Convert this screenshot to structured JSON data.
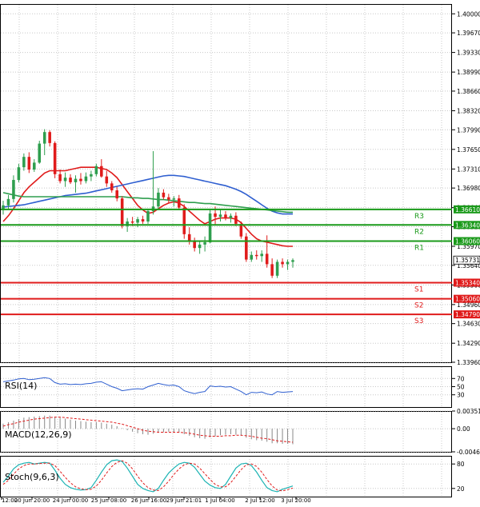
{
  "chart_data": [
    {
      "type": "candlestick",
      "panel": "price",
      "y_ticks": [
        "1.40000",
        "1.39670",
        "1.39330",
        "1.38990",
        "1.38660",
        "1.38320",
        "1.37990",
        "1.37650",
        "1.37310",
        "1.36980",
        "1.36640",
        "1.36310",
        "1.35970",
        "1.35640",
        "1.35300",
        "1.34960",
        "1.34630",
        "1.34290",
        "1.33960"
      ],
      "ylim": [
        1.3396,
        1.4017
      ],
      "x_ticks": [
        "12:00",
        "20 Jun 20:00",
        "24 Jun 00:00",
        "25 Jun 08:00",
        "26 Jun 16:00",
        "29 Jun 21:01",
        "1 Jul 04:00",
        "2 Jul 12:00",
        "3 Jul 20:00"
      ],
      "candles": [
        [
          1.366,
          1.3676,
          1.3652,
          1.3668
        ],
        [
          1.3668,
          1.3686,
          1.3662,
          1.3679
        ],
        [
          1.3679,
          1.372,
          1.3673,
          1.3712
        ],
        [
          1.3712,
          1.374,
          1.3708,
          1.3734
        ],
        [
          1.3734,
          1.3758,
          1.3728,
          1.3752
        ],
        [
          1.3752,
          1.376,
          1.3724,
          1.373
        ],
        [
          1.373,
          1.3748,
          1.3726,
          1.3742
        ],
        [
          1.3742,
          1.378,
          1.374,
          1.3775
        ],
        [
          1.3775,
          1.38,
          1.3755,
          1.3795
        ],
        [
          1.3795,
          1.3798,
          1.377,
          1.3776
        ],
        [
          1.3776,
          1.3779,
          1.3715,
          1.3722
        ],
        [
          1.3722,
          1.373,
          1.3706,
          1.371
        ],
        [
          1.371,
          1.3725,
          1.37,
          1.3716
        ],
        [
          1.3716,
          1.3722,
          1.3705,
          1.3708
        ],
        [
          1.3708,
          1.372,
          1.369,
          1.3714
        ],
        [
          1.3714,
          1.3724,
          1.3704,
          1.371
        ],
        [
          1.371,
          1.3725,
          1.3706,
          1.3718
        ],
        [
          1.3718,
          1.3728,
          1.371,
          1.3722
        ],
        [
          1.3722,
          1.374,
          1.3718,
          1.3736
        ],
        [
          1.3736,
          1.3748,
          1.3716,
          1.3718
        ],
        [
          1.3718,
          1.3728,
          1.37,
          1.3706
        ],
        [
          1.3706,
          1.371,
          1.369,
          1.3694
        ],
        [
          1.3694,
          1.37,
          1.3675,
          1.368
        ],
        [
          1.368,
          1.3684,
          1.3628,
          1.3632
        ],
        [
          1.3632,
          1.3646,
          1.3622,
          1.364
        ],
        [
          1.364,
          1.3648,
          1.3632,
          1.3638
        ],
        [
          1.3638,
          1.3648,
          1.363,
          1.3644
        ],
        [
          1.3644,
          1.365,
          1.3636,
          1.364
        ],
        [
          1.364,
          1.3662,
          1.3636,
          1.3658
        ],
        [
          1.3658,
          1.3762,
          1.3652,
          1.3666
        ],
        [
          1.3666,
          1.3698,
          1.366,
          1.369
        ],
        [
          1.369,
          1.3696,
          1.3678,
          1.3682
        ],
        [
          1.3682,
          1.3688,
          1.3672,
          1.3678
        ],
        [
          1.3678,
          1.3684,
          1.3666,
          1.368
        ],
        [
          1.368,
          1.3686,
          1.366,
          1.3664
        ],
        [
          1.3664,
          1.367,
          1.361,
          1.3618
        ],
        [
          1.3618,
          1.363,
          1.36,
          1.3606
        ],
        [
          1.3606,
          1.3612,
          1.3588,
          1.3594
        ],
        [
          1.3594,
          1.3606,
          1.3584,
          1.36
        ],
        [
          1.36,
          1.3614,
          1.3588,
          1.3604
        ],
        [
          1.3604,
          1.3662,
          1.3602,
          1.3654
        ],
        [
          1.3654,
          1.3666,
          1.3634,
          1.3648
        ],
        [
          1.3648,
          1.366,
          1.364,
          1.3652
        ],
        [
          1.3652,
          1.3658,
          1.3642,
          1.3646
        ],
        [
          1.3646,
          1.3654,
          1.3638,
          1.365
        ],
        [
          1.365,
          1.3656,
          1.3632,
          1.3636
        ],
        [
          1.3636,
          1.364,
          1.361,
          1.3614
        ],
        [
          1.3614,
          1.362,
          1.357,
          1.3574
        ],
        [
          1.3574,
          1.3588,
          1.357,
          1.3582
        ],
        [
          1.3582,
          1.359,
          1.3574,
          1.358
        ],
        [
          1.358,
          1.359,
          1.357,
          1.3584
        ],
        [
          1.3584,
          1.3616,
          1.356,
          1.3566
        ],
        [
          1.3566,
          1.3576,
          1.3542,
          1.3546
        ],
        [
          1.3546,
          1.3574,
          1.3542,
          1.357
        ],
        [
          1.357,
          1.3576,
          1.356,
          1.3566
        ],
        [
          1.3566,
          1.3574,
          1.3556,
          1.357
        ],
        [
          1.357,
          1.3576,
          1.356,
          1.3573
        ]
      ],
      "moving_averages": [
        {
          "color": "#e01b1b",
          "values": [
            1.364,
            1.365,
            1.3662,
            1.3676,
            1.369,
            1.37,
            1.3708,
            1.3716,
            1.3724,
            1.3728,
            1.3728,
            1.3728,
            1.3728,
            1.373,
            1.3732,
            1.3734,
            1.3734,
            1.3734,
            1.3734,
            1.3732,
            1.373,
            1.3724,
            1.3716,
            1.3704,
            1.3692,
            1.368,
            1.3668,
            1.366,
            1.3654,
            1.3656,
            1.3662,
            1.3668,
            1.3672,
            1.3674,
            1.3672,
            1.3666,
            1.3658,
            1.365,
            1.3642,
            1.3636,
            1.364,
            1.3644,
            1.3646,
            1.3646,
            1.3646,
            1.3644,
            1.3638,
            1.3628,
            1.3618,
            1.361,
            1.3606,
            1.3604,
            1.3602,
            1.36,
            1.3598,
            1.3597,
            1.3597
          ]
        },
        {
          "color": "#2f5fd0",
          "values": [
            1.3665,
            1.3666,
            1.3667,
            1.3668,
            1.3669,
            1.3671,
            1.3673,
            1.3675,
            1.3677,
            1.3679,
            1.3681,
            1.3683,
            1.3685,
            1.3686,
            1.3687,
            1.3688,
            1.3689,
            1.3691,
            1.3693,
            1.3695,
            1.3697,
            1.3699,
            1.3701,
            1.3703,
            1.3705,
            1.3707,
            1.3709,
            1.3711,
            1.3713,
            1.3715,
            1.3717,
            1.3719,
            1.372,
            1.372,
            1.3719,
            1.3718,
            1.3716,
            1.3714,
            1.3712,
            1.371,
            1.3708,
            1.3706,
            1.3704,
            1.3702,
            1.3699,
            1.3696,
            1.3692,
            1.3687,
            1.3681,
            1.3675,
            1.3669,
            1.3663,
            1.3658,
            1.3655,
            1.3653,
            1.3653,
            1.3653
          ]
        },
        {
          "color": "#2e9e4e",
          "values": [
            1.369,
            1.3688,
            1.3686,
            1.3684,
            1.3683,
            1.3683,
            1.3683,
            1.3683,
            1.3683,
            1.3683,
            1.3683,
            1.3683,
            1.3683,
            1.3683,
            1.3683,
            1.3683,
            1.3683,
            1.3683,
            1.3683,
            1.3683,
            1.3683,
            1.3683,
            1.3683,
            1.3683,
            1.3682,
            1.3681,
            1.3681,
            1.368,
            1.368,
            1.3679,
            1.3678,
            1.3678,
            1.3677,
            1.3676,
            1.3675,
            1.3674,
            1.3673,
            1.3673,
            1.3672,
            1.3671,
            1.3671,
            1.367,
            1.3669,
            1.3668,
            1.3667,
            1.3666,
            1.3665,
            1.3664,
            1.3663,
            1.3662,
            1.3661,
            1.366,
            1.3659,
            1.3658,
            1.3657,
            1.3656,
            1.3656
          ]
        }
      ],
      "current_price": "1.35731",
      "levels": [
        {
          "label": "R3",
          "value_label": "1.36610",
          "value": 1.3661,
          "kind": "resistance",
          "color": "#1a9a1a"
        },
        {
          "label": "R2",
          "value_label": "1.36340",
          "value": 1.3634,
          "kind": "resistance",
          "color": "#1a9a1a"
        },
        {
          "label": "R1",
          "value_label": "1.36060",
          "value": 1.3606,
          "kind": "resistance",
          "color": "#1a9a1a"
        },
        {
          "label": "S1",
          "value_label": "1.35340",
          "value": 1.3534,
          "kind": "support",
          "color": "#e01b1b"
        },
        {
          "label": "S2",
          "value_label": "1.35060",
          "value": 1.3506,
          "kind": "support",
          "color": "#e01b1b"
        },
        {
          "label": "S3",
          "value_label": "1.34790",
          "value": 1.3479,
          "kind": "support",
          "color": "#e01b1b"
        }
      ],
      "colors": {
        "bull": "#2e9e4e",
        "bear": "#e01b1b"
      }
    },
    {
      "type": "line",
      "panel": "rsi",
      "title": "RSI(14)",
      "y_ticks": [
        "70",
        "50",
        "30"
      ],
      "ylim": [
        0,
        100
      ],
      "values": [
        62,
        64,
        66,
        69,
        70,
        67,
        68,
        70,
        72,
        70,
        60,
        56,
        57,
        55,
        56,
        55,
        57,
        58,
        61,
        62,
        56,
        50,
        46,
        40,
        42,
        44,
        45,
        44,
        50,
        54,
        58,
        55,
        53,
        54,
        50,
        40,
        36,
        33,
        36,
        38,
        52,
        50,
        51,
        49,
        50,
        44,
        38,
        30,
        36,
        35,
        37,
        32,
        30,
        38,
        36,
        37,
        38
      ],
      "color": "#2f5fd0"
    },
    {
      "type": "bar",
      "panel": "macd",
      "title": "MACD(12,26,9)",
      "y_ticks": [
        "0.003512",
        "0.00",
        "-0.004602"
      ],
      "ylim": [
        -0.004602,
        0.003512
      ],
      "values": [
        0.001,
        0.0013,
        0.0016,
        0.0019,
        0.0022,
        0.0023,
        0.0024,
        0.0025,
        0.0026,
        0.0026,
        0.0024,
        0.0022,
        0.002,
        0.0018,
        0.0016,
        0.0015,
        0.0014,
        0.0013,
        0.0013,
        0.0012,
        0.001,
        0.0008,
        0.0005,
        0.0001,
        -0.0003,
        -0.0006,
        -0.0009,
        -0.0011,
        -0.0012,
        -0.001,
        -0.0008,
        -0.0007,
        -0.0006,
        -0.0006,
        -0.0008,
        -0.0011,
        -0.0014,
        -0.0017,
        -0.0019,
        -0.002,
        -0.0017,
        -0.0015,
        -0.0013,
        -0.0012,
        -0.0011,
        -0.0012,
        -0.0014,
        -0.0018,
        -0.0021,
        -0.0023,
        -0.0024,
        -0.0026,
        -0.0029,
        -0.0029,
        -0.003,
        -0.003,
        -0.0031
      ],
      "signal": [
        0.0005,
        0.0008,
        0.001,
        0.0013,
        0.0015,
        0.0017,
        0.0019,
        0.002,
        0.0021,
        0.0022,
        0.0023,
        0.0023,
        0.0022,
        0.0021,
        0.002,
        0.0019,
        0.0018,
        0.0017,
        0.0016,
        0.0015,
        0.0014,
        0.0013,
        0.0011,
        0.0009,
        0.0006,
        0.0003,
        0.0,
        -0.0003,
        -0.0005,
        -0.0006,
        -0.0007,
        -0.0007,
        -0.0007,
        -0.0007,
        -0.0007,
        -0.0008,
        -0.0009,
        -0.0011,
        -0.0013,
        -0.0014,
        -0.0015,
        -0.0015,
        -0.0015,
        -0.0014,
        -0.0014,
        -0.0013,
        -0.0013,
        -0.0014,
        -0.0015,
        -0.0017,
        -0.0019,
        -0.002,
        -0.0022,
        -0.0024,
        -0.0025,
        -0.0026,
        -0.0027
      ],
      "bar_color": "#888888",
      "signal_color": "#e01b1b"
    },
    {
      "type": "line",
      "panel": "stoch",
      "title": "Stoch(9,6,3)",
      "y_ticks": [
        "80",
        "20"
      ],
      "ylim": [
        0,
        100
      ],
      "main": [
        35,
        50,
        68,
        78,
        82,
        84,
        80,
        82,
        84,
        82,
        65,
        45,
        30,
        22,
        18,
        16,
        17,
        22,
        40,
        60,
        78,
        88,
        90,
        86,
        70,
        50,
        30,
        20,
        15,
        12,
        20,
        40,
        58,
        70,
        80,
        84,
        82,
        72,
        55,
        38,
        28,
        22,
        20,
        30,
        50,
        70,
        80,
        82,
        76,
        60,
        40,
        22,
        15,
        12,
        18,
        22,
        26
      ],
      "signal": [
        30,
        40,
        55,
        68,
        76,
        80,
        80,
        81,
        82,
        82,
        76,
        62,
        47,
        34,
        24,
        19,
        17,
        18,
        26,
        40,
        58,
        74,
        84,
        88,
        82,
        68,
        50,
        34,
        22,
        16,
        15,
        24,
        38,
        54,
        68,
        78,
        82,
        80,
        70,
        56,
        42,
        30,
        24,
        24,
        34,
        50,
        66,
        78,
        80,
        74,
        60,
        42,
        26,
        16,
        14,
        17,
        21
      ],
      "main_color": "#1bb3b3",
      "signal_color": "#e01b1b"
    }
  ]
}
